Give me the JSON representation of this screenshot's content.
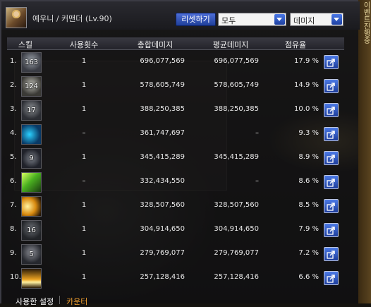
{
  "window": {
    "character_name": "예우니 / 커맨더 (Lv.90)",
    "reset_button": "리셋하기",
    "filter_dropdown": "모두",
    "sort_dropdown": "데미지"
  },
  "side_strip_text": "이벤트진행중",
  "table": {
    "columns": [
      "스킬",
      "사용횟수",
      "총합데미지",
      "평균데미지",
      "점유율"
    ],
    "rows": [
      {
        "rank": "1.",
        "skill_level": "163",
        "uses": "1",
        "total": "696,077,569",
        "avg": "696,077,569",
        "share": "17.9 %"
      },
      {
        "rank": "2.",
        "skill_level": "124",
        "uses": "1",
        "total": "578,605,749",
        "avg": "578,605,749",
        "share": "14.9 %"
      },
      {
        "rank": "3.",
        "skill_level": "17",
        "uses": "1",
        "total": "388,250,385",
        "avg": "388,250,385",
        "share": "10.0 %"
      },
      {
        "rank": "4.",
        "skill_level": "",
        "uses": "–",
        "total": "361,747,697",
        "avg": "–",
        "share": "9.3 %"
      },
      {
        "rank": "5.",
        "skill_level": "9",
        "uses": "1",
        "total": "345,415,289",
        "avg": "345,415,289",
        "share": "8.9 %"
      },
      {
        "rank": "6.",
        "skill_level": "",
        "uses": "–",
        "total": "332,434,550",
        "avg": "–",
        "share": "8.6 %"
      },
      {
        "rank": "7.",
        "skill_level": "",
        "uses": "1",
        "total": "328,507,560",
        "avg": "328,507,560",
        "share": "8.5 %"
      },
      {
        "rank": "8.",
        "skill_level": "16",
        "uses": "1",
        "total": "304,914,650",
        "avg": "304,914,650",
        "share": "7.9 %"
      },
      {
        "rank": "9.",
        "skill_level": "5",
        "uses": "1",
        "total": "279,769,077",
        "avg": "279,769,077",
        "share": "7.2 %"
      },
      {
        "rank": "10.",
        "skill_level": "",
        "uses": "1",
        "total": "257,128,416",
        "avg": "257,128,416",
        "share": "6.6 %"
      }
    ]
  },
  "tabs": {
    "settings": "사용한 설정",
    "counter": "카운터"
  }
}
